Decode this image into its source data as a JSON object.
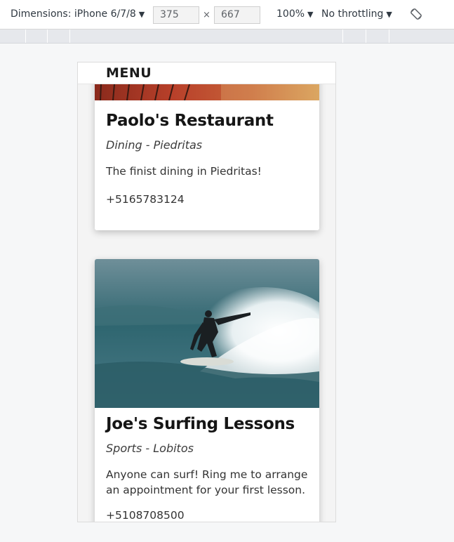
{
  "devtools": {
    "dimensions_label": "Dimensions: iPhone 6/7/8",
    "width_value": "375",
    "times": "×",
    "height_value": "667",
    "zoom": "100%",
    "throttling": "No throttling",
    "caret": "▼",
    "rotate_icon": "rotate-icon"
  },
  "page": {
    "menu_label": "MENU",
    "cards": [
      {
        "title": "Paolo's Restaurant",
        "category": "Dining - Piedritas",
        "description": "The finist dining in Piedritas!",
        "phone": "+5165783124"
      },
      {
        "title": "Joe's Surfing Lessons",
        "category": "Sports - Lobitos",
        "description": "Anyone can surf! Ring me to arrange an appointment for your first lesson.",
        "phone": "+5108708500"
      }
    ]
  },
  "colors": {
    "toolbar_bg": "#ffffff",
    "ruler_bg": "#e6e8ec",
    "page_bg": "#f6f7f8",
    "title": "#151515"
  }
}
